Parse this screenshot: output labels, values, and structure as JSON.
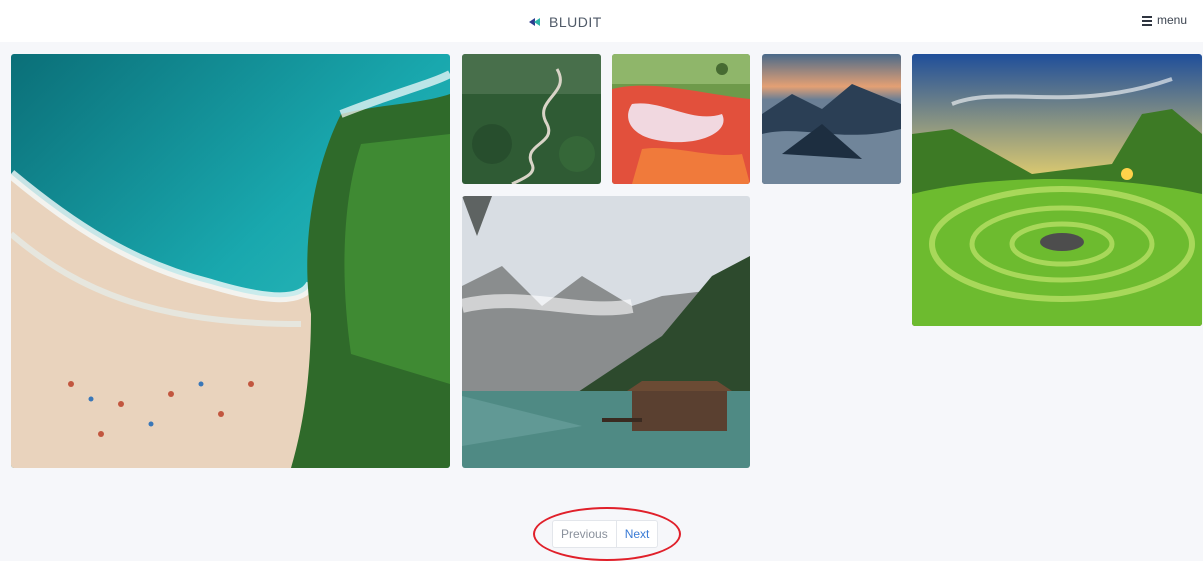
{
  "header": {
    "brand_name": "BLUDIT",
    "brand_icon": "bludit-logo-icon",
    "menu_label": "menu",
    "menu_icon": "hamburger-icon"
  },
  "gallery": {
    "images": [
      {
        "subject": "beach-aerial-photo"
      },
      {
        "subject": "winding-forest-road-photo"
      },
      {
        "subject": "red-lake-aerial-photo"
      },
      {
        "subject": "misty-mountain-valley-photo"
      },
      {
        "subject": "sunset-grass-spiral-photo"
      },
      {
        "subject": "mountain-lake-boathouse-photo"
      }
    ]
  },
  "pagination": {
    "previous_label": "Previous",
    "next_label": "Next"
  },
  "colors": {
    "page_background": "#f6f7fa",
    "header_background": "#ffffff",
    "link_active": "#3a7bd5",
    "highlight_ring": "#e0202a"
  }
}
